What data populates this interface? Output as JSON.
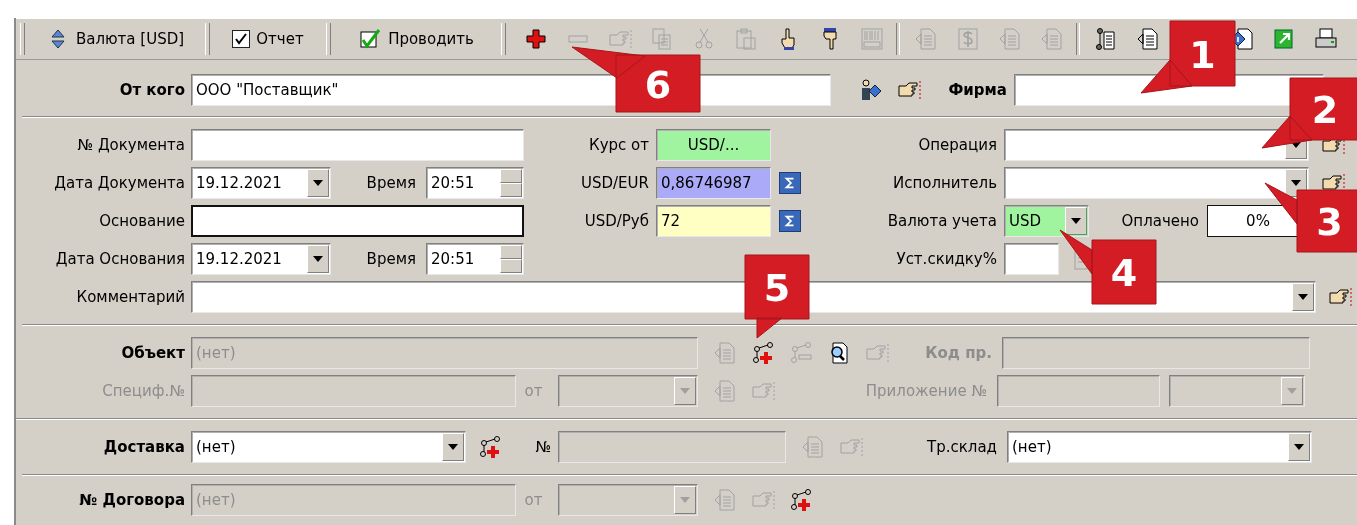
{
  "toolbar": {
    "buttons": [
      {
        "kind": "currency",
        "label": "Валюта [USD]"
      },
      {
        "kind": "checkbox",
        "label": "Отчет",
        "checked": true
      },
      {
        "kind": "post",
        "label": "Проводить",
        "checked": true
      }
    ],
    "icon_groups": [
      [
        {
          "disabled": false
        },
        {
          "disabled": true
        },
        {
          "disabled": true
        },
        {
          "disabled": true
        },
        {
          "disabled": true
        },
        {
          "disabled": true
        },
        {
          "disabled": false
        },
        {
          "disabled": false
        },
        {
          "disabled": true
        }
      ],
      [
        {
          "disabled": true
        },
        {
          "disabled": true
        },
        {
          "disabled": true
        },
        {
          "disabled": true
        }
      ],
      [
        {
          "disabled": false
        },
        {
          "disabled": false
        },
        {
          "disabled": false
        },
        {
          "disabled": false
        },
        {
          "disabled": false
        }
      ]
    ]
  },
  "supplier": {
    "label": "От кого",
    "value": "ООО \"Поставщик\"",
    "icons": [
      {
        "disabled": false
      },
      {
        "disabled": false
      }
    ]
  },
  "firm": {
    "label": "Фирма"
  },
  "document_no": {
    "label": "№ Документа"
  },
  "doc_date": {
    "label": "Дата Документа",
    "value": "19.12.2021"
  },
  "doc_time": {
    "label": "Время",
    "value": "20:51"
  },
  "basis": {
    "label": "Основание",
    "focused": true
  },
  "basis_date": {
    "label": "Дата Основания",
    "value": "19.12.2021"
  },
  "basis_time": {
    "label": "Время",
    "value": "20:51"
  },
  "comment": {
    "label": "Комментарий",
    "icons": [
      {
        "disabled": false
      }
    ]
  },
  "rates": [
    {
      "kind": "plain",
      "label": "Курс от",
      "value": "USD/...",
      "color": "#a0f4a0"
    },
    {
      "kind": "summable",
      "label": "USD/EUR",
      "value": "0,86746987",
      "color": "#aaaaf8"
    },
    {
      "kind": "summable",
      "label": "USD/Руб",
      "value": "72",
      "color": "#ffffc4"
    }
  ],
  "operation": {
    "label": "Операция",
    "icons": [
      {
        "disabled": false
      }
    ]
  },
  "executor": {
    "label": "Исполнитель",
    "icons": [
      {
        "disabled": false
      }
    ]
  },
  "account_currency": {
    "label": "Валюта учета",
    "value": "USD"
  },
  "paid": {
    "label": "Оплачено",
    "value": "0%"
  },
  "discount": {
    "label": "Уст.скидку%",
    "icons": [
      {
        "disabled": true
      }
    ]
  },
  "object": {
    "label": "Объект",
    "value": "(нет)",
    "disabled": true,
    "icons": [
      {
        "disabled": true
      },
      {
        "disabled": false
      },
      {
        "disabled": true
      },
      {
        "disabled": false
      },
      {
        "disabled": true
      }
    ]
  },
  "product_code": {
    "label": "Код пр.",
    "disabled": true,
    "label_disabled": true
  },
  "spec": {
    "label": "Специф.№",
    "disabled": true,
    "label_disabled": true
  },
  "spec_from": {
    "label": "от",
    "disabled": true,
    "label_disabled": true,
    "icons": [
      {
        "disabled": true
      },
      {
        "disabled": true
      }
    ]
  },
  "appendix": {
    "label": "Приложение №",
    "disabled": true,
    "label_disabled": true
  },
  "delivery": {
    "label": "Доставка",
    "value": "(нет)",
    "icons": [
      {
        "disabled": false
      }
    ]
  },
  "delivery_no": {
    "label": "№",
    "disabled": true,
    "icons": [
      {
        "disabled": true
      },
      {
        "disabled": true
      }
    ]
  },
  "transit_warehouse": {
    "label": "Тр.склад",
    "value": "(нет)"
  },
  "contract": {
    "label": "№ Договора",
    "value": "(нет)",
    "disabled": true
  },
  "contract_from": {
    "label": "от",
    "disabled": true,
    "label_disabled": true,
    "icons": [
      {
        "disabled": true
      },
      {
        "disabled": true
      },
      {
        "disabled": false
      }
    ]
  },
  "callouts": [
    {
      "label": "1"
    },
    {
      "label": "2"
    },
    {
      "label": "3"
    },
    {
      "label": "4"
    },
    {
      "label": "5"
    },
    {
      "label": "6"
    }
  ]
}
